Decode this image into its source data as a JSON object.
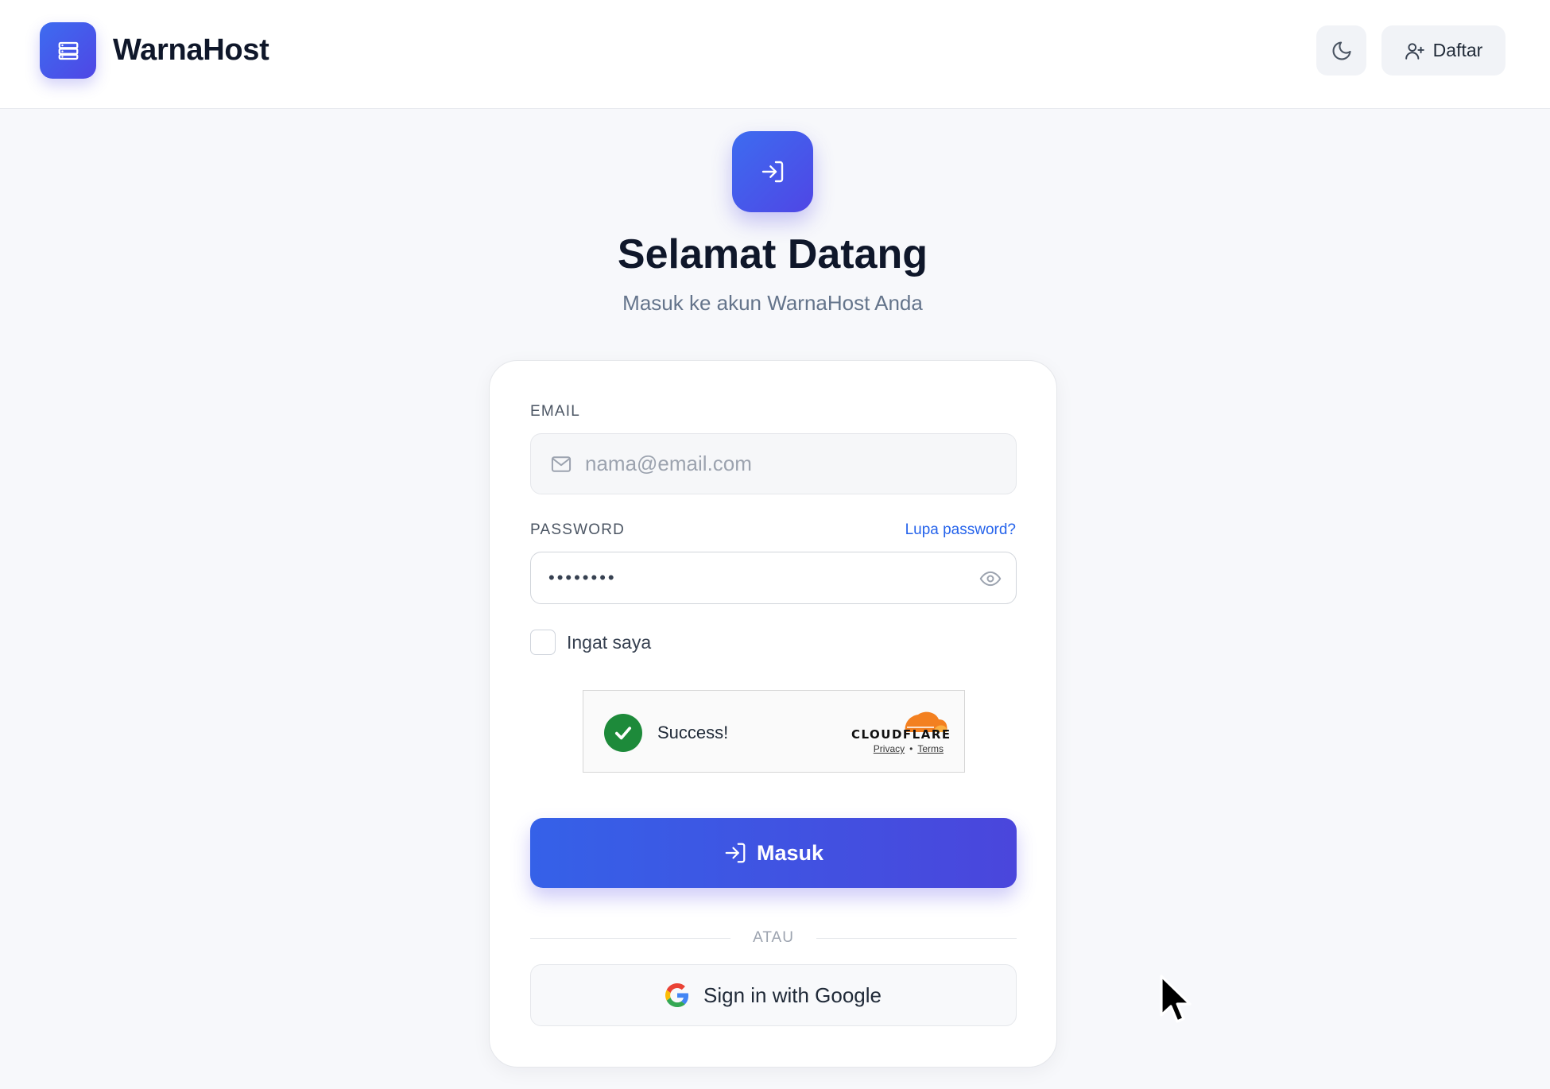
{
  "header": {
    "brand_name": "WarnaHost",
    "theme_toggle_icon": "moon-icon",
    "register_label": "Daftar"
  },
  "hero": {
    "icon": "login-icon",
    "title": "Selamat Datang",
    "subtitle": "Masuk ke akun WarnaHost Anda"
  },
  "form": {
    "email": {
      "label": "EMAIL",
      "placeholder": "nama@email.com",
      "value": ""
    },
    "password": {
      "label": "PASSWORD",
      "masked_value": "••••••••",
      "forgot_label": "Lupa password?"
    },
    "remember": {
      "label": "Ingat saya",
      "checked": false
    },
    "captcha": {
      "status": "Success!",
      "provider": "CLOUDFLARE",
      "privacy_label": "Privacy",
      "separator": "•",
      "terms_label": "Terms"
    },
    "submit_label": "Masuk",
    "divider_label": "ATAU",
    "google_label": "Sign in with Google"
  },
  "colors": {
    "accent": "#4f46e5",
    "accent_blue": "#3561e8",
    "link": "#2563eb",
    "success": "#1d8a3a",
    "cloudflare_orange": "#f38020"
  }
}
